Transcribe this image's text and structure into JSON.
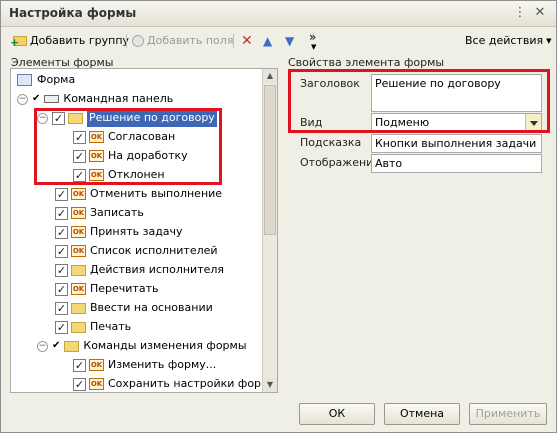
{
  "window": {
    "title": "Настройка формы"
  },
  "toolbar": {
    "add_group": "Добавить группу",
    "add_field": "Добавить поля",
    "more": "»",
    "all_actions": "Все действия"
  },
  "left_panel": {
    "label": "Элементы формы"
  },
  "tree": {
    "items": [
      {
        "label": "Форма"
      },
      {
        "label": "Командная панель"
      },
      {
        "label": "Решение по договору"
      },
      {
        "label": "Согласован"
      },
      {
        "label": "На доработку"
      },
      {
        "label": "Отклонен"
      },
      {
        "label": "Отменить выполнение"
      },
      {
        "label": "Записать"
      },
      {
        "label": "Принять задачу"
      },
      {
        "label": "Список исполнителей"
      },
      {
        "label": "Действия исполнителя"
      },
      {
        "label": "Перечитать"
      },
      {
        "label": "Ввести на основании"
      },
      {
        "label": "Печать"
      },
      {
        "label": "Команды изменения формы"
      },
      {
        "label": "Изменить форму..."
      },
      {
        "label": "Сохранить настройки формы"
      }
    ]
  },
  "right_panel": {
    "label": "Свойства элемента формы",
    "title_label": "Заголовок",
    "title_value": "Решение по договору",
    "view_label": "Вид",
    "view_value": "Подменю",
    "hint_label": "Подсказка",
    "hint_value": "Кнопки выполнения задачи",
    "display_label": "Отображение",
    "display_value": "Авто"
  },
  "buttons": {
    "ok": "ОК",
    "cancel": "Отмена",
    "apply": "Применить"
  },
  "colors": {
    "highlight_box": "#e0141e",
    "selection": "#3e67b8"
  }
}
